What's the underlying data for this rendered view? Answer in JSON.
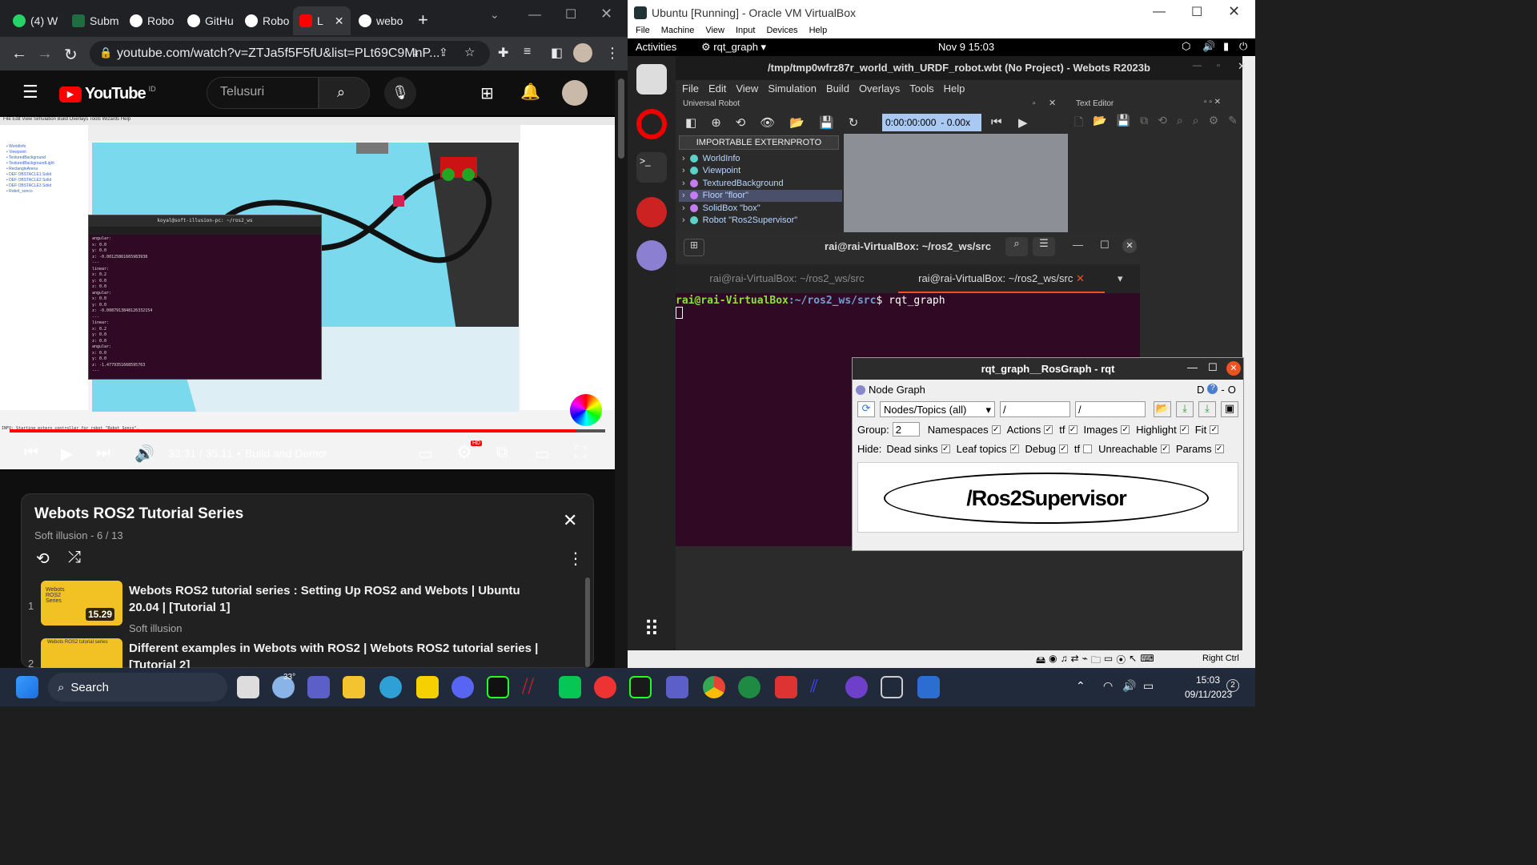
{
  "chrome": {
    "tabs": [
      {
        "label": "(4) W",
        "icon": "whatsapp-icon",
        "color": "#25d366"
      },
      {
        "label": "Subm",
        "icon": "excel-icon",
        "color": "#1d6f42"
      },
      {
        "label": "Robo",
        "icon": "github-icon",
        "color": "#ffffff"
      },
      {
        "label": "GitHu",
        "icon": "github-icon",
        "color": "#ffffff"
      },
      {
        "label": "Robo",
        "icon": "github-icon",
        "color": "#ffffff"
      },
      {
        "label": "L",
        "icon": "youtube-icon",
        "color": "#ff0000"
      },
      {
        "label": "webo",
        "icon": "github-icon",
        "color": "#ffffff"
      }
    ],
    "new_tab": "+",
    "url": "youtube.com/watch?v=ZTJa5f5F5fU&list=PLt69C9MnP..."
  },
  "youtube": {
    "logo": "YouTube",
    "region": "ID",
    "search_placeholder": "Telusuri",
    "player": {
      "time": "33:31 / 35:11",
      "chapter": "Build and Demo",
      "separator": "•",
      "progress_fraction": 0.952,
      "hd_badge": "HD"
    },
    "playlist": {
      "title": "Webots ROS2 Tutorial Series",
      "meta": "Soft illusion - 6 / 13",
      "items": [
        {
          "index": "1",
          "title": "Webots ROS2 tutorial series : Setting Up ROS2 and Webots | Ubuntu 20.04 | [Tutorial 1]",
          "channel": "Soft illusion",
          "duration": "15.29",
          "thumb_title": "Webots ROS2 Series"
        },
        {
          "index": "2",
          "title": "Different examples in Webots with ROS2 | Webots ROS2 tutorial series | [Tutorial 2]",
          "channel": "",
          "duration": "",
          "thumb_title": "Webots ROS2 tutorial series"
        }
      ]
    },
    "video_terminal": {
      "title": "koyal@soft-illusion-pc: ~/ros2_ws",
      "lines": [
        "angular:",
        "  x: 0.0",
        "  y: 0.0",
        "  z: -0.00125861665983938",
        "---",
        "linear:",
        "  x: 0.2",
        "  y: 0.0",
        "  z: 0.0",
        "angular:",
        "  x: 0.0",
        "  y: 0.0",
        "  z: -0.0087913848126332154",
        "---",
        "linear:",
        "  x: 0.2",
        "  y: 0.0",
        "  z: 0.0",
        "angular:",
        "  x: 0.0",
        "  y: 0.0",
        "  z: -1.4779351668595763",
        "---"
      ]
    },
    "video_console": "INFO: Starting extern controller for robot \"Robot_Sonco\"."
  },
  "vbox": {
    "title": "Ubuntu [Running] - Oracle VM VirtualBox",
    "menu": [
      "File",
      "Machine",
      "View",
      "Input",
      "Devices",
      "Help"
    ],
    "host_key": "Right Ctrl"
  },
  "ubuntu": {
    "activities": "Activities",
    "app": "rqt_graph",
    "clock": "Nov 9  15:03"
  },
  "webots": {
    "title": "/tmp/tmp0wfrz87r_world_with_URDF_robot.wbt (No Project) - Webots R2023b",
    "menu": [
      "File",
      "Edit",
      "View",
      "Simulation",
      "Build",
      "Overlays",
      "Tools",
      "Help"
    ],
    "panel_left": "Universal Robot",
    "panel_right": "Text Editor",
    "time": "0:00:00:000",
    "speed": "-  0.00x",
    "externproto": "IMPORTABLE EXTERNPROTO",
    "nodes": [
      {
        "label": "WorldInfo",
        "color": "#5bd1c7"
      },
      {
        "label": "Viewpoint",
        "color": "#5bd1c7"
      },
      {
        "label": "TexturedBackground",
        "color": "#c57cf2"
      },
      {
        "label": "Floor \"floor\"",
        "color": "#c57cf2"
      },
      {
        "label": "SolidBox \"box\"",
        "color": "#c57cf2"
      },
      {
        "label": "Robot \"Ros2Supervisor\"",
        "color": "#5bd1c7"
      }
    ]
  },
  "terminal": {
    "title": "rai@rai-VirtualBox: ~/ros2_ws/src",
    "tabs": [
      "rai@rai-VirtualBox: ~/ros2_ws/src",
      "rai@rai-VirtualBox: ~/ros2_ws/src"
    ],
    "prompt_user": "rai@rai-VirtualBox",
    "prompt_path": ":~/ros2_ws/src",
    "prompt_sym": "$ ",
    "command": "rqt_graph"
  },
  "rqt": {
    "title": "rqt_graph__RosGraph - rqt",
    "plugin": "Node Graph",
    "plugin_tools": "D",
    "mode": "Nodes/Topics (all)",
    "filter1": "/",
    "filter2": "/",
    "group_label": "Group:",
    "group_value": "2",
    "row1": [
      {
        "label": "Namespaces",
        "checked": "✓"
      },
      {
        "label": "Actions",
        "checked": "✓"
      },
      {
        "label": "tf",
        "checked": "✓"
      },
      {
        "label": "Images",
        "checked": "✓"
      },
      {
        "label": "Highlight",
        "checked": "✓"
      },
      {
        "label": "Fit",
        "checked": "✓"
      }
    ],
    "hide_label": "Hide:",
    "row2": [
      {
        "label": "Dead sinks",
        "checked": "✓"
      },
      {
        "label": "Leaf topics",
        "checked": "✓"
      },
      {
        "label": "Debug",
        "checked": "✓"
      },
      {
        "label": "tf",
        "checked": ""
      },
      {
        "label": "Unreachable",
        "checked": "✓"
      },
      {
        "label": "Params",
        "checked": "✓"
      }
    ],
    "node": "/Ros2Supervisor"
  },
  "taskbar": {
    "search": "Search",
    "weather": "33°",
    "time": "15:03",
    "date": "09/11/2023",
    "notifications": "2"
  }
}
